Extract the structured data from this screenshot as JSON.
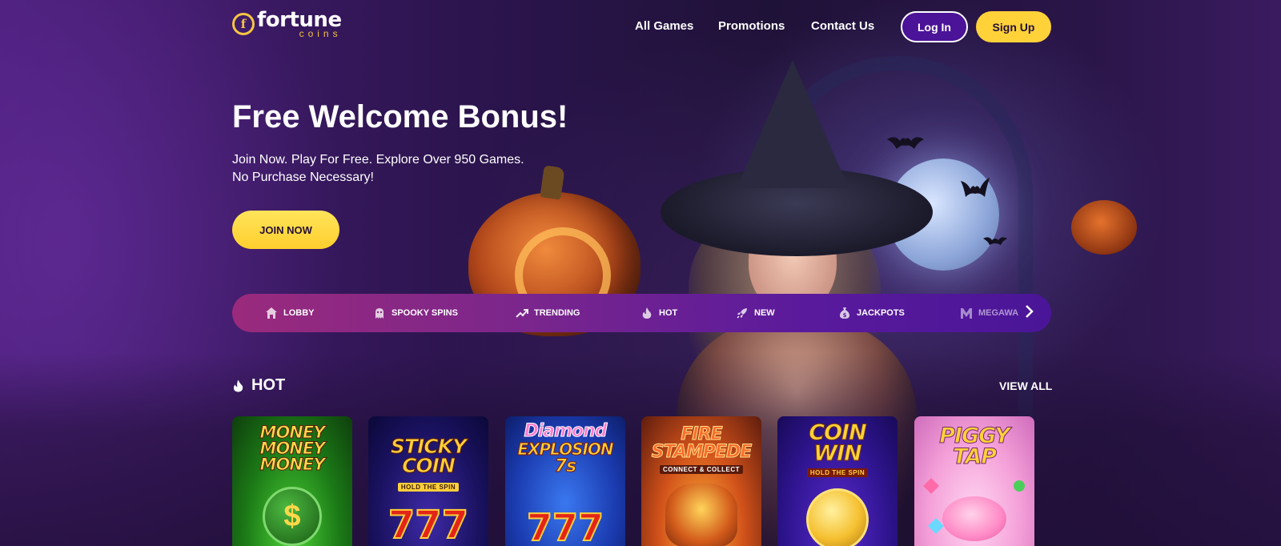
{
  "brand": {
    "name": "fortune",
    "sub": "coins",
    "mark": "f"
  },
  "nav": {
    "all_games": "All Games",
    "promotions": "Promotions",
    "contact": "Contact Us"
  },
  "auth": {
    "login": "Log In",
    "signup": "Sign Up"
  },
  "hero": {
    "title": "Free Welcome Bonus!",
    "line1": "Join Now. Play For Free. Explore Over 950 Games.",
    "line2": "No Purchase Necessary!",
    "cta": "JOIN NOW"
  },
  "categories": [
    {
      "label": "LOBBY",
      "icon": "home-icon"
    },
    {
      "label": "SPOOKY SPINS",
      "icon": "ghost-icon"
    },
    {
      "label": "TRENDING",
      "icon": "trending-icon"
    },
    {
      "label": "HOT",
      "icon": "flame-icon"
    },
    {
      "label": "NEW",
      "icon": "rocket-icon"
    },
    {
      "label": "JACKPOTS",
      "icon": "money-bag-icon"
    },
    {
      "label": "MEGAWA",
      "icon": "megaways-icon"
    }
  ],
  "section": {
    "title": "HOT",
    "view_all": "VIEW ALL",
    "icon": "flame-icon"
  },
  "games": [
    {
      "title": "MONEY MONEY MONEY",
      "l1": "MONEY",
      "l2": "MONEY",
      "l3": "MONEY",
      "sub": "",
      "art": "$"
    },
    {
      "title": "STICKY COIN",
      "l1": "STICKY",
      "l2": "COIN",
      "l3": "",
      "sub": "HOLD THE SPIN",
      "art": "777"
    },
    {
      "title": "Diamond Explosion 7s",
      "l1": "Diamond",
      "l2": "EXPLOSION",
      "l3": "7s",
      "sub": "",
      "art": "777"
    },
    {
      "title": "FIRE STAMPEDE",
      "l1": "FIRE",
      "l2": "STAMPEDE",
      "l3": "",
      "sub": "CONNECT & COLLECT",
      "art": ""
    },
    {
      "title": "COIN WIN",
      "l1": "COIN",
      "l2": "WIN",
      "l3": "",
      "sub": "HOLD THE SPIN",
      "art": ""
    },
    {
      "title": "PIGGY TAP",
      "l1": "PIGGY",
      "l2": "TAP",
      "l3": "",
      "sub": "",
      "art": ""
    }
  ],
  "colors": {
    "accent_yellow": "#ffd23a",
    "login_purple": "#4a1398",
    "bar_start": "#9a2a7c",
    "bar_end": "#4a1598"
  }
}
